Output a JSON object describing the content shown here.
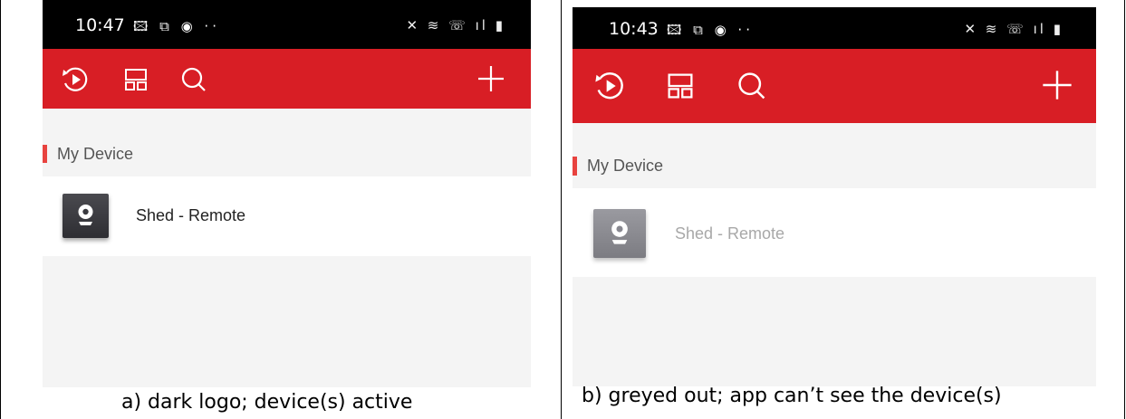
{
  "panel_a": {
    "time": "10:47",
    "notif_icons": "🖾 ⧉ ◉ ··",
    "sys_icons": "✕ ≋ ☏ ıl ▮",
    "section_label": "My Device",
    "device_name": "Shed - Remote",
    "device_state": "active",
    "caption": "a) dark logo; device(s) active"
  },
  "panel_b": {
    "time": "10:43",
    "notif_icons": "🖾 ⧉ ◉ ··",
    "sys_icons": "✕ ≋ ☏ ıl ▮",
    "section_label": "My Device",
    "device_name": "Shed - Remote",
    "device_state": "offline",
    "caption": "b) greyed out; app can’t see the device(s)"
  },
  "toolbar": {
    "icons": [
      "playback-icon",
      "layout-icon",
      "search-icon",
      "add-icon"
    ]
  },
  "colors": {
    "toolbar_red": "#d81e25",
    "section_accent": "#e8433f",
    "device_name_active": "#222222",
    "device_name_offline": "#a8a8a8"
  }
}
